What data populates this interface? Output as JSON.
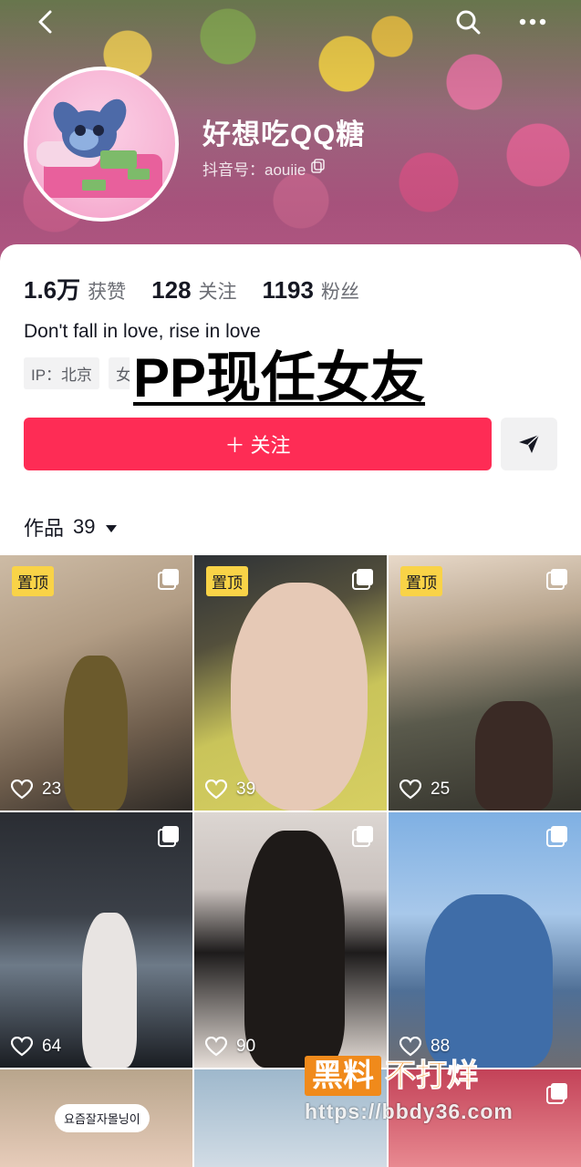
{
  "header": {
    "name": "好想吃QQ糖",
    "douyin_id": "抖音号：aouiie"
  },
  "stats": [
    {
      "num": "1.6万",
      "label": "获赞"
    },
    {
      "num": "128",
      "label": "关注"
    },
    {
      "num": "1193",
      "label": "粉丝"
    }
  ],
  "bio": "Don't fall in love, rise in love",
  "tags": [
    "IP：北京",
    "女"
  ],
  "overlay_title": "PP现任女友",
  "follow_label": "＋ 关注",
  "works": {
    "label": "作品",
    "count": "39"
  },
  "grid": [
    {
      "pinned": "置顶",
      "likes": "23"
    },
    {
      "pinned": "置顶",
      "likes": "39"
    },
    {
      "pinned": "置顶",
      "likes": "25"
    },
    {
      "pinned": "",
      "likes": "64"
    },
    {
      "pinned": "",
      "likes": "90"
    },
    {
      "pinned": "",
      "likes": "88"
    },
    {
      "pinned": "",
      "likes": "",
      "caption": "요즘잘자몰닝이"
    },
    {
      "pinned": "",
      "likes": ""
    },
    {
      "pinned": "",
      "likes": ""
    }
  ],
  "watermark": {
    "box": "黑料",
    "text": "不打烊",
    "url": "https://bbdy36.com"
  },
  "colors": {
    "follow": "#fe2c55",
    "pin_badge": "#f9d347",
    "watermark": "#f08a1b"
  },
  "icons": [
    "back-icon",
    "search-icon",
    "more-icon",
    "copy-icon",
    "share-icon",
    "dropdown-icon",
    "multi-image-icon",
    "heart-icon"
  ]
}
